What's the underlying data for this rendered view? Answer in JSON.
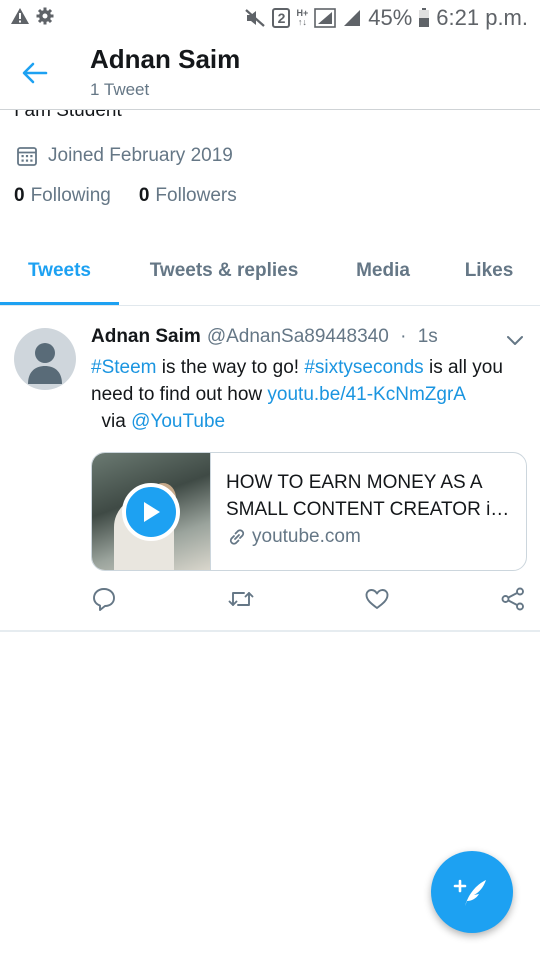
{
  "status_bar": {
    "sim_badge": "2",
    "network_label_top": "H+",
    "network_label_bottom": "↑↓",
    "battery": "45%",
    "time": "6:21 p.m.",
    "icons": [
      "warning-icon",
      "settings-icon",
      "mute-icon",
      "sim-badge",
      "network-type-icon",
      "signal-icon",
      "signal-icon",
      "battery-icon"
    ]
  },
  "header": {
    "title": "Adnan Saim",
    "subtitle": "1 Tweet",
    "back_icon": "arrow-left-icon"
  },
  "profile": {
    "bio": "I am Student",
    "joined": "Joined February 2019",
    "following_count": "0",
    "following_label": "Following",
    "followers_count": "0",
    "followers_label": "Followers"
  },
  "tabs": [
    {
      "label": "Tweets",
      "active": true
    },
    {
      "label": "Tweets & replies",
      "active": false
    },
    {
      "label": "Media",
      "active": false
    },
    {
      "label": "Likes",
      "active": false
    }
  ],
  "tweet": {
    "name": "Adnan Saim",
    "handle": "@AdnanSa89448340",
    "separator": "·",
    "time": "1s",
    "text": {
      "hashtag1": "#Steem",
      "text1": " is the way to go! ",
      "hashtag2": "#sixtyseconds",
      "text2": " is all you need to find out how ",
      "url": "youtu.be/41-KcNmZgrA",
      "text3": "  via ",
      "mention": "@YouTube"
    },
    "card": {
      "title": "HOW TO EARN MONEY AS A SMALL CONTENT CREATOR i…",
      "domain": "youtube.com"
    },
    "actions": [
      "reply-icon",
      "retweet-icon",
      "like-icon",
      "share-icon"
    ]
  },
  "fab": {
    "icon": "compose-tweet-icon"
  },
  "colors": {
    "accent": "#1da1f2",
    "link": "#1b95e0",
    "secondary_text": "#657786",
    "primary_text": "#14171a"
  }
}
